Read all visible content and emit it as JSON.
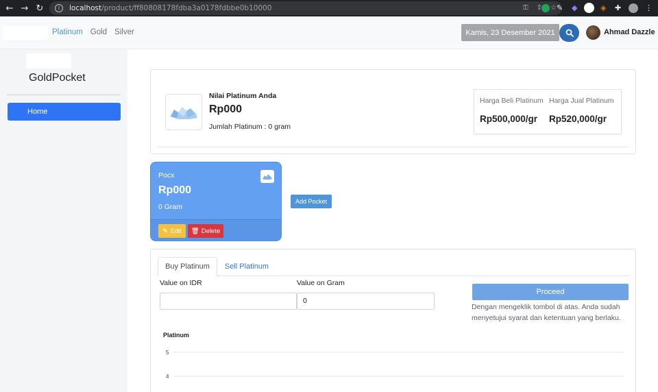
{
  "browser": {
    "url_host": "localhost",
    "url_path": "/product/ff80808178fdba3a0178fdbbe0b10000"
  },
  "navbar": {
    "links": [
      {
        "label": "Platinum",
        "active": true
      },
      {
        "label": "Gold",
        "active": false
      },
      {
        "label": "Silver",
        "active": false
      }
    ],
    "date": "Kamis, 23 Desember 2021",
    "user_name": "Ahmad Dazzle"
  },
  "sidebar": {
    "title": "GoldPocket",
    "items": [
      {
        "label": "Home",
        "active": true
      }
    ]
  },
  "summary": {
    "label": "Nilai Platinum Anda",
    "value": "Rp000",
    "quantity": "Jumlah Platinum : 0 gram",
    "buy_label": "Harga Beli Platinum",
    "buy_value": "Rp500,000/gr",
    "sell_label": "Harga Jual Platinum",
    "sell_value": "Rp520,000/gr"
  },
  "pocket": {
    "name": "Pocx",
    "value": "Rp000",
    "gram": "0 Gram",
    "edit_label": "Edit",
    "delete_label": "Delete"
  },
  "add_pocket_label": "Add Pocket",
  "trade": {
    "tabs": [
      {
        "label": "Buy Platinum",
        "active": true
      },
      {
        "label": "Sell Platinum",
        "active": false
      }
    ],
    "idr_label": "Value on IDR",
    "idr_value": "",
    "gram_label": "Value on Gram",
    "gram_value": "0",
    "proceed_label": "Proceed",
    "agreement": "Dengan mengeklik tombol di atas. Anda sudah menyetujui syarat dan ketentuan yang berlaku."
  },
  "chart_data": {
    "type": "line",
    "title": "Platinum",
    "y_ticks": [
      "5",
      "4"
    ],
    "series": []
  },
  "colors": {
    "primary": "#2f74f5",
    "pocket_card": "#64a0f2",
    "edit": "#f6c23e",
    "delete": "#d9363e",
    "search_button": "#2e6bb3"
  }
}
